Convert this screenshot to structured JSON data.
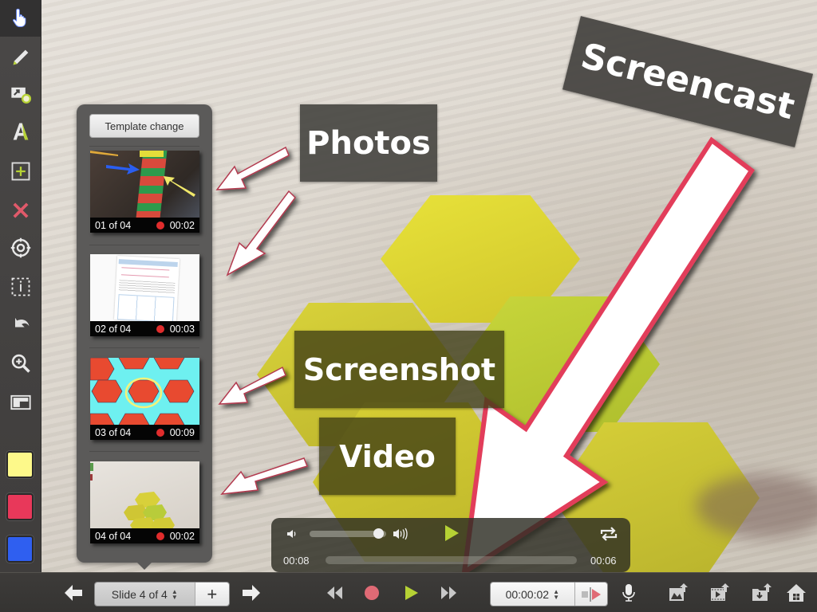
{
  "toolbar": {
    "tools": [
      {
        "name": "pointer",
        "icon": "hand-pointer-icon",
        "active": true
      },
      {
        "name": "pen",
        "icon": "pencil-icon"
      },
      {
        "name": "insert-image",
        "icon": "image-insert-icon"
      },
      {
        "name": "text",
        "icon": "text-a-icon"
      },
      {
        "name": "add",
        "icon": "add-box-icon"
      },
      {
        "name": "delete",
        "icon": "delete-x-icon"
      },
      {
        "name": "target",
        "icon": "target-icon"
      },
      {
        "name": "selection",
        "icon": "dashed-select-icon"
      },
      {
        "name": "undo",
        "icon": "undo-icon"
      },
      {
        "name": "zoom",
        "icon": "zoom-in-icon"
      },
      {
        "name": "layout",
        "icon": "layout-icon"
      }
    ],
    "swatches": [
      {
        "name": "yellow",
        "color": "#fdf98a"
      },
      {
        "name": "red",
        "color": "#e8385a"
      },
      {
        "name": "blue",
        "color": "#2f5ff0"
      }
    ]
  },
  "slide_panel": {
    "template_button": "Template change",
    "slides": [
      {
        "index": "01 of 04",
        "duration": "00:02",
        "kind": "photo"
      },
      {
        "index": "02 of 04",
        "duration": "00:03",
        "kind": "photo"
      },
      {
        "index": "03 of 04",
        "duration": "00:09",
        "kind": "screenshot"
      },
      {
        "index": "04 of 04",
        "duration": "00:02",
        "kind": "video"
      }
    ]
  },
  "annotations": {
    "photos": "Photos",
    "screenshot": "Screenshot",
    "video": "Video",
    "screencast": "Screencast"
  },
  "player": {
    "elapsed": "00:08",
    "remaining": "00:06",
    "volume": 0.9,
    "progress": 0.0
  },
  "bottombar": {
    "slide_label": "Slide 4 of 4",
    "add_label": "+",
    "time_value": "00:00:02"
  },
  "colors": {
    "accent_green": "#b6d234",
    "record_red": "#e06a75",
    "arrow_red": "#e23d5a"
  }
}
